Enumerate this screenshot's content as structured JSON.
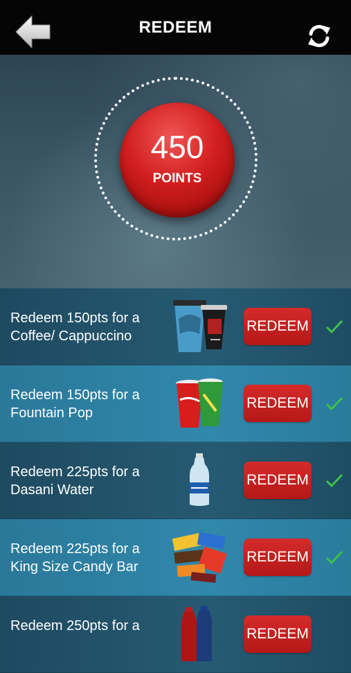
{
  "header": {
    "title": "REDEEM",
    "back_icon": "back-arrow-icon",
    "refresh_icon": "refresh-icon"
  },
  "points": {
    "value": "450",
    "label": "POINTS"
  },
  "colors": {
    "accent": "#c91f1f",
    "check": "#3cc24a",
    "topbar": "#050505"
  },
  "rewards": [
    {
      "text": "Redeem 150pts for a Coffee/ Cappuccino",
      "button": "REDEEM",
      "image": "coffee-cups",
      "checked": true
    },
    {
      "text": "Redeem 150pts for a Fountain Pop",
      "button": "REDEEM",
      "image": "fountain-pop-cups",
      "checked": true
    },
    {
      "text": "Redeem 225pts for a Dasani Water",
      "button": "REDEEM",
      "image": "water-bottle",
      "checked": true
    },
    {
      "text": "Redeem 225pts for a King Size Candy Bar",
      "button": "REDEEM",
      "image": "candy-bars",
      "checked": true
    },
    {
      "text": "Redeem 250pts for a",
      "button": "REDEEM",
      "image": "soda-bottles",
      "checked": false
    }
  ]
}
